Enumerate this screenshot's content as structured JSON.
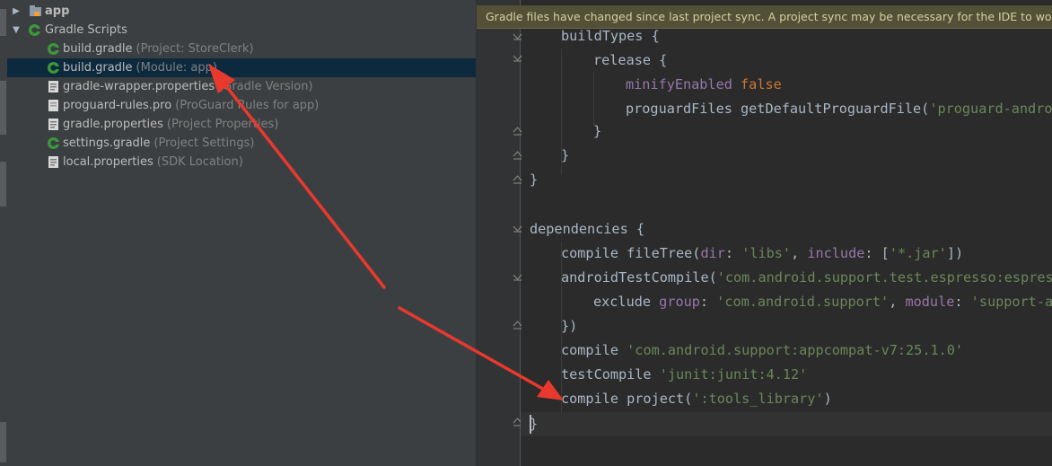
{
  "project_tree": {
    "rows": [
      {
        "arrow": "▶",
        "name": "app",
        "hint": "",
        "icon": "folder-icon",
        "selected": false,
        "bold": true
      },
      {
        "arrow": "▼",
        "name": "Gradle Scripts",
        "hint": "",
        "icon": "gradle-icon",
        "selected": false,
        "bold": false
      },
      {
        "arrow": "",
        "name": "build.gradle",
        "hint": "(Project: StoreClerk)",
        "icon": "gradle-icon",
        "selected": false,
        "bold": false
      },
      {
        "arrow": "",
        "name": "build.gradle",
        "hint": "(Module: app)",
        "icon": "gradle-icon",
        "selected": true,
        "bold": false
      },
      {
        "arrow": "",
        "name": "gradle-wrapper.properties",
        "hint": "(Gradle Version)",
        "icon": "properties-file-icon",
        "selected": false,
        "bold": false
      },
      {
        "arrow": "",
        "name": "proguard-rules.pro",
        "hint": "(ProGuard Rules for app)",
        "icon": "file-icon",
        "selected": false,
        "bold": false
      },
      {
        "arrow": "",
        "name": "gradle.properties",
        "hint": "(Project Properties)",
        "icon": "properties-file-icon",
        "selected": false,
        "bold": false
      },
      {
        "arrow": "",
        "name": "settings.gradle",
        "hint": "(Project Settings)",
        "icon": "gradle-icon",
        "selected": false,
        "bold": false
      },
      {
        "arrow": "",
        "name": "local.properties",
        "hint": "(SDK Location)",
        "icon": "properties-file-icon",
        "selected": false,
        "bold": false
      }
    ]
  },
  "banner": {
    "text": "Gradle files have changed since last project sync. A project sync may be necessary for the IDE to work prope"
  },
  "code": {
    "l1": {
      "kw": "buildTypes",
      "rest": " {"
    },
    "l2": {
      "a": "release",
      "b": " {"
    },
    "l3": {
      "a": "minifyEnabled",
      "b": " ",
      "c": "false"
    },
    "l4": {
      "a": "proguardFiles getDefaultProguardFile(",
      "b": "'proguard-androi"
    },
    "l5": "}",
    "l6": "}",
    "l7": "}",
    "l8": {
      "a": "dependencies",
      "b": " {"
    },
    "l9": {
      "a": "compile fileTree(",
      "b": "dir",
      "c": ": ",
      "d": "'libs'",
      "e": ", ",
      "f": "include",
      "g": ": [",
      "h": "'*.jar'",
      "i": "])"
    },
    "l10": {
      "a": "androidTestCompile(",
      "b": "'com.android.support.test.espresso:espress"
    },
    "l11": {
      "a": "exclude ",
      "b": "group",
      "c": ": ",
      "d": "'com.android.support'",
      "e": ", ",
      "f": "module",
      "g": ": ",
      "h": "'support-an"
    },
    "l12": "})",
    "l13": {
      "a": "compile ",
      "b": "'com.android.support:appcompat-v7:25.1.0'"
    },
    "l14": {
      "a": "testCompile ",
      "b": "'junit:junit:4.12'"
    },
    "l15": {
      "a": "compile project(",
      "b": "':tools_library'",
      "c": ")"
    },
    "l16": "}"
  },
  "colors": {
    "annotation_arrow": "#e8392e",
    "selection": "#0d293e",
    "banner_bg": "#525037"
  }
}
